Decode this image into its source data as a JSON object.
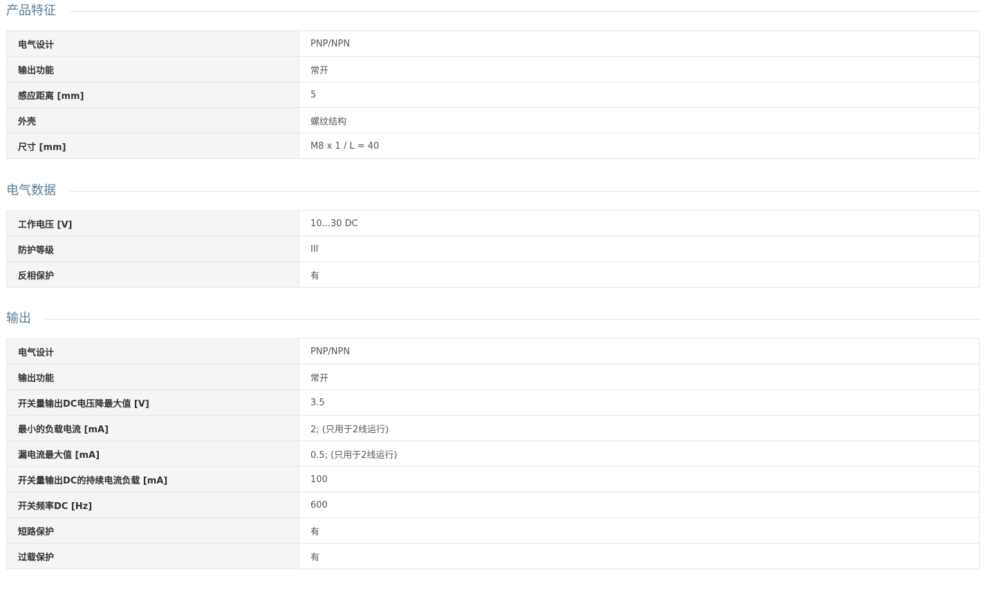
{
  "sections": [
    {
      "title": "产品特征",
      "rows": [
        {
          "label": "电气设计",
          "value": "PNP/NPN"
        },
        {
          "label": "输出功能",
          "value": "常开"
        },
        {
          "label": "感应距离 [mm]",
          "value": "5"
        },
        {
          "label": "外壳",
          "value": "螺纹结构"
        },
        {
          "label": "尺寸 [mm]",
          "value": "M8 x 1 / L = 40"
        }
      ]
    },
    {
      "title": "电气数据",
      "rows": [
        {
          "label": "工作电压 [V]",
          "value": "10...30 DC"
        },
        {
          "label": "防护等级",
          "value": "III"
        },
        {
          "label": "反相保护",
          "value": "有"
        }
      ]
    },
    {
      "title": "输出",
      "rows": [
        {
          "label": "电气设计",
          "value": "PNP/NPN"
        },
        {
          "label": "输出功能",
          "value": "常开"
        },
        {
          "label": "开关量输出DC电压降最大值 [V]",
          "value": "3.5"
        },
        {
          "label": "最小的负载电流 [mA]",
          "value": "2; (只用于2线运行)"
        },
        {
          "label": "漏电流最大值 [mA]",
          "value": "0.5; (只用于2线运行)"
        },
        {
          "label": "开关量输出DC的持续电流负载 [mA]",
          "value": "100"
        },
        {
          "label": "开关频率DC [Hz]",
          "value": "600"
        },
        {
          "label": "短路保护",
          "value": "有"
        },
        {
          "label": "过载保护",
          "value": "有"
        }
      ]
    }
  ]
}
